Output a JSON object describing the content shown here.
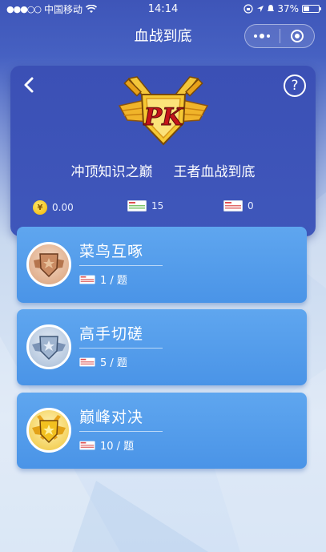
{
  "status_bar": {
    "carrier": "中国移动",
    "time": "14:14",
    "battery": "37%",
    "battery_level": 0.37
  },
  "nav": {
    "title": "血战到底"
  },
  "header": {
    "emblem_text": "PK",
    "slogan_left": "冲顶知识之巅",
    "slogan_right": "王者血战到底",
    "help_label": "?",
    "stats": {
      "coins": "0.00",
      "tickets_green": "15",
      "tickets_red": "0"
    }
  },
  "levels": [
    {
      "title": "菜鸟互啄",
      "cost": "1 / 题",
      "tier": "bronze"
    },
    {
      "title": "高手切磋",
      "cost": "5 / 题",
      "tier": "silver"
    },
    {
      "title": "巅峰对决",
      "cost": "10 / 题",
      "tier": "gold"
    }
  ],
  "colors": {
    "header_bg": "#3b50b5",
    "card_bg": "#4a94e7",
    "coin": "#f1b500",
    "bronze": "#c98a62",
    "silver": "#9fb4cf",
    "gold": "#f2c020"
  }
}
